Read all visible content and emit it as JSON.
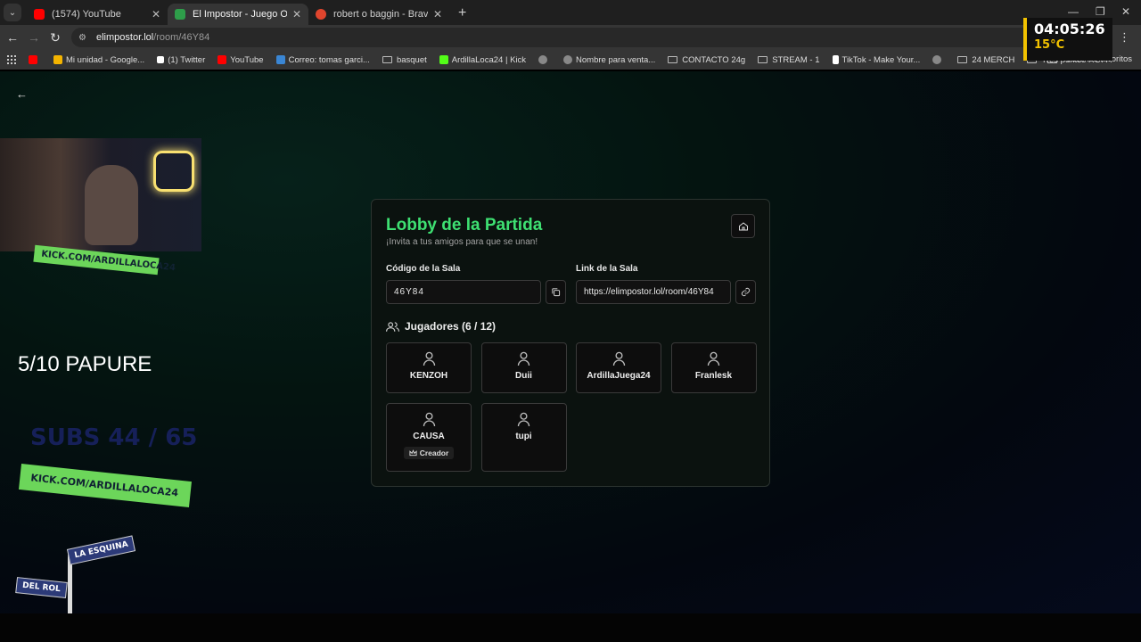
{
  "browser": {
    "tabs": [
      {
        "label": "(1574) YouTube",
        "color": "#ff0000",
        "active": false
      },
      {
        "label": "El Impostor - Juego Online Gra",
        "color": "#2e9e4a",
        "active": true
      },
      {
        "label": "robert o baggin - Brave Search",
        "color": "#e0452d",
        "active": false
      }
    ],
    "url_host": "elimpostor.lol",
    "url_path": "/room/46Y84",
    "bookmarks": [
      {
        "label": "",
        "kind": "youtube",
        "color": "#ff0000"
      },
      {
        "label": "Mi unidad - Google...",
        "kind": "drive",
        "color": "#f4b400"
      },
      {
        "label": "(1) Twitter",
        "kind": "x",
        "color": "#ffffff"
      },
      {
        "label": "YouTube",
        "kind": "youtube",
        "color": "#ff0000"
      },
      {
        "label": "Correo: tomas garci...",
        "kind": "mail",
        "color": "#3a86d4"
      },
      {
        "label": "basquet",
        "kind": "folder"
      },
      {
        "label": "ArdillaLoca24 | Kick",
        "kind": "kick",
        "color": "#53fc18"
      },
      {
        "label": "",
        "kind": "globe",
        "color": "#888888"
      },
      {
        "label": "Nombre para venta...",
        "kind": "globe",
        "color": "#888888"
      },
      {
        "label": "CONTACTO 24g",
        "kind": "folder"
      },
      {
        "label": "STREAM - 1",
        "kind": "folder"
      },
      {
        "label": "TikTok - Make Your...",
        "kind": "tiktok",
        "color": "#ffffff"
      },
      {
        "label": "",
        "kind": "globe",
        "color": "#888888"
      },
      {
        "label": "24 MERCH",
        "kind": "folder"
      },
      {
        "label": "Tres puntos  ROPA",
        "kind": "folder"
      }
    ],
    "all_bookmarks": "Todos los favoritos"
  },
  "clock": {
    "time": "04:05:26",
    "temp": "15°C"
  },
  "lobby": {
    "title": "Lobby de la Partida",
    "subtitle": "¡Invita a tus amigos para que se unan!",
    "room_code_label": "Código de la Sala",
    "room_code": "46Y84",
    "room_link_label": "Link de la Sala",
    "room_link": "https://elimpostor.lol/room/46Y84",
    "players_heading": "Jugadores (6 / 12)",
    "players": [
      {
        "name": "KENZOH"
      },
      {
        "name": "Duii"
      },
      {
        "name": "ArdillaJuega24"
      },
      {
        "name": "Franlesk"
      },
      {
        "name": "CAUSA",
        "badge": "Creador"
      },
      {
        "name": "tupi"
      }
    ],
    "accent": "#3ee072"
  },
  "overlay": {
    "kick_text": "KICK.COM/ARDILLALOCA24",
    "papure": "5/10 PAPURE",
    "subs": "SUBS 44 / 65",
    "sign_top": "LA ESQUINA",
    "sign_bottom": "DEL ROL"
  }
}
